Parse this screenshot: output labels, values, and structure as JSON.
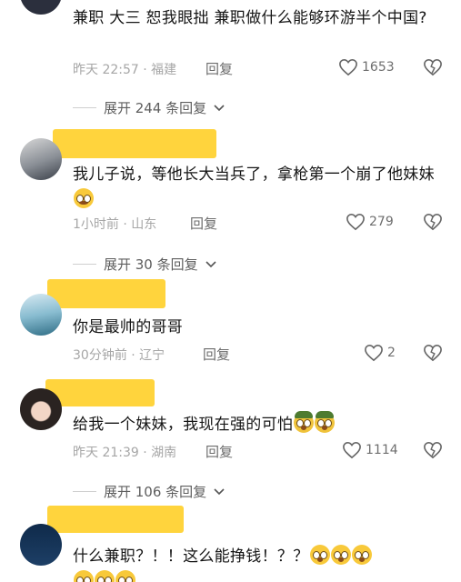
{
  "comments": [
    {
      "text": "兼职 大三 恕我眼拙 兼职做什么能够环游半个中国?",
      "time": "昨天 22:57 · 福建",
      "reply": "回复",
      "likes": "1653"
    },
    {
      "text": "我儿子说，等他长大当兵了，拿枪第一个崩了他妹妹",
      "time": "1小时前 · 山东",
      "reply": "回复",
      "likes": "279"
    },
    {
      "text": "你是最帅的哥哥",
      "time": "30分钟前 · 辽宁",
      "reply": "回复",
      "likes": "2"
    },
    {
      "text": "给我一个妹妹，我现在强的可怕",
      "time": "昨天 21:39 · 湖南",
      "reply": "回复",
      "likes": "1114"
    },
    {
      "text": "什么兼职？！！这么能挣钱！？？"
    }
  ],
  "expand": [
    "展开 244 条回复",
    "展开 30 条回复",
    "展开 106 条回复"
  ],
  "colors": {
    "mask": "#ffd233",
    "meta": "#a6a6a6"
  }
}
